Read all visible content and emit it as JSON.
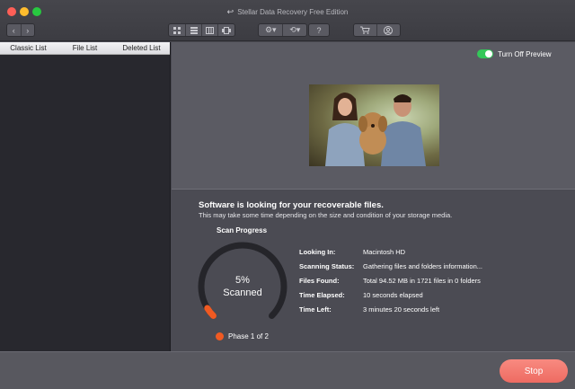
{
  "window": {
    "title": "Stellar Data Recovery Free Edition",
    "traffic_lights": [
      "close",
      "minimize",
      "zoom"
    ]
  },
  "toolbar": {
    "nav": [
      "chevron-left-icon",
      "chevron-right-icon"
    ],
    "view_modes": [
      "grid-view-icon",
      "list-view-icon",
      "column-view-icon",
      "coverflow-view-icon"
    ],
    "settings": [
      "gear-icon",
      "recovery-icon"
    ],
    "help_label": "?",
    "cart": "cart-icon",
    "account": "user-icon"
  },
  "left_panel": {
    "tabs": [
      {
        "label": "Classic List"
      },
      {
        "label": "File List"
      },
      {
        "label": "Deleted List"
      }
    ]
  },
  "preview": {
    "toggle_label": "Turn Off Preview",
    "toggle_on": true
  },
  "scan": {
    "message_title": "Software is looking for your recoverable files.",
    "message_sub": "This may take some time depending on the size and condition of your storage media.",
    "progress_title": "Scan Progress",
    "percent_label": "5%",
    "scanned_label": "Scanned",
    "progress_fraction": 0.05,
    "phase_label": "Phase 1 of 2",
    "details": [
      {
        "key": "Looking In:",
        "value": "Macintosh HD"
      },
      {
        "key": "Scanning Status:",
        "value": "Gathering files and folders information..."
      },
      {
        "key": "Files Found:",
        "value": "Total 94.52 MB in 1721 files in 0 folders"
      },
      {
        "key": "Time Elapsed:",
        "value": "10 seconds elapsed"
      },
      {
        "key": "Time Left:",
        "value": "3 minutes 20 seconds left"
      }
    ]
  },
  "footer": {
    "stop_label": "Stop"
  },
  "colors": {
    "accent_orange": "#f05a22",
    "stop_button": "#ee6b62",
    "toggle_green": "#34c759"
  }
}
